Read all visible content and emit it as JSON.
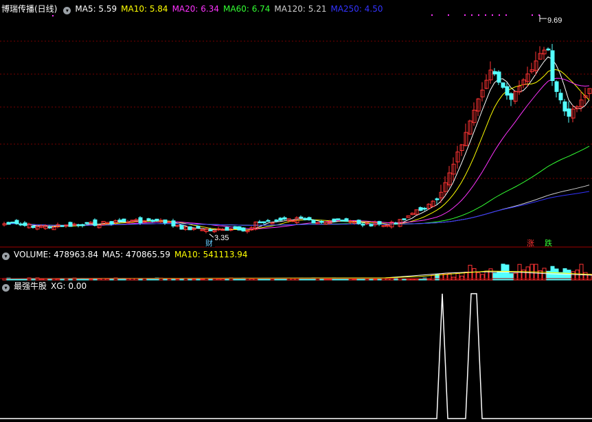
{
  "main_pane": {
    "title": "博瑞传播(日线)",
    "indicators": [
      {
        "label": "MA5: 5.59",
        "color": "#ffffff"
      },
      {
        "label": "MA10: 5.84",
        "color": "#ffff00"
      },
      {
        "label": "MA20: 6.34",
        "color": "#ff33ff"
      },
      {
        "label": "MA60: 6.74",
        "color": "#33ff33"
      },
      {
        "label": "MA120: 5.21",
        "color": "#cfcfcf"
      },
      {
        "label": "MA250: 4.50",
        "color": "#3333ff"
      }
    ],
    "high_label": "9.69",
    "low_label": "3.35",
    "finance_marker": "财",
    "rise_label": "涨",
    "fall_label": "跌"
  },
  "volume_pane": {
    "indicators": [
      {
        "label": "VOLUME: 478963.84",
        "color": "#ffffff"
      },
      {
        "label": "MA5: 470865.59",
        "color": "#ffffff"
      },
      {
        "label": "MA10: 541113.94",
        "color": "#ffff00"
      }
    ]
  },
  "signal_pane": {
    "indicators": [
      {
        "label": "最强牛股",
        "color": "#ffffff"
      },
      {
        "label": "XG: 0.00",
        "color": "#ffffff"
      }
    ]
  },
  "colors": {
    "up": "#ff3333",
    "down": "#54ffff",
    "grid": "#7a0000",
    "background": "#000000"
  },
  "chart_data": {
    "type": "candlestick",
    "price_high": 9.69,
    "price_low": 3.35,
    "volume": 478963.84,
    "signal_xg": 0.0
  }
}
